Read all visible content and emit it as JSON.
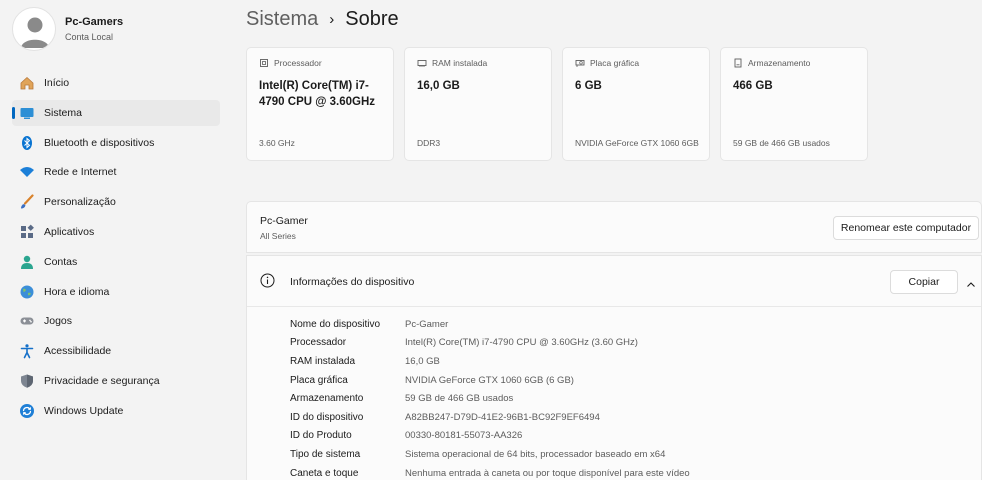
{
  "profile": {
    "name": "Pc-Gamers",
    "account": "Conta Local"
  },
  "nav": [
    {
      "label": "Início",
      "icon": "home-icon"
    },
    {
      "label": "Sistema",
      "icon": "system-icon",
      "active": true
    },
    {
      "label": "Bluetooth e dispositivos",
      "icon": "bluetooth-icon"
    },
    {
      "label": "Rede e Internet",
      "icon": "wifi-icon"
    },
    {
      "label": "Personalização",
      "icon": "brush-icon"
    },
    {
      "label": "Aplicativos",
      "icon": "apps-icon"
    },
    {
      "label": "Contas",
      "icon": "account-icon"
    },
    {
      "label": "Hora e idioma",
      "icon": "globe-icon"
    },
    {
      "label": "Jogos",
      "icon": "gamepad-icon"
    },
    {
      "label": "Acessibilidade",
      "icon": "accessibility-icon"
    },
    {
      "label": "Privacidade e segurança",
      "icon": "shield-icon"
    },
    {
      "label": "Windows Update",
      "icon": "update-icon"
    }
  ],
  "breadcrumb": {
    "parent": "Sistema",
    "separator": "›",
    "current": "Sobre"
  },
  "cards": [
    {
      "title": "Processador",
      "value": "Intel(R) Core(TM) i7-4790 CPU @ 3.60GHz",
      "sub": "3.60 GHz",
      "icon": "processor-icon"
    },
    {
      "title": "RAM instalada",
      "value": "16,0 GB",
      "sub": "DDR3",
      "icon": "ram-icon"
    },
    {
      "title": "Placa gráfica",
      "value": "6 GB",
      "sub": "NVIDIA GeForce GTX 1060 6GB",
      "icon": "gpu-icon"
    },
    {
      "title": "Armazenamento",
      "value": "466 GB",
      "sub": "59 GB de 466 GB usados",
      "icon": "storage-icon"
    }
  ],
  "pc": {
    "name": "Pc-Gamer",
    "model": "All Series",
    "rename_label": "Renomear este computador"
  },
  "device_info": {
    "title": "Informações do dispositivo",
    "copy_label": "Copiar",
    "specs": [
      {
        "label": "Nome do dispositivo",
        "value": "Pc-Gamer"
      },
      {
        "label": "Processador",
        "value": "Intel(R) Core(TM) i7-4790 CPU @ 3.60GHz (3.60 GHz)"
      },
      {
        "label": "RAM instalada",
        "value": "16,0 GB"
      },
      {
        "label": "Placa gráfica",
        "value": "NVIDIA GeForce GTX 1060 6GB (6 GB)"
      },
      {
        "label": "Armazenamento",
        "value": "59 GB de 466 GB usados"
      },
      {
        "label": "ID do dispositivo",
        "value": "A82BB247-D79D-41E2-96B1-BC92F9EF6494"
      },
      {
        "label": "ID do Produto",
        "value": "00330-80181-55073-AA326"
      },
      {
        "label": "Tipo de sistema",
        "value": "Sistema operacional de 64 bits, processador baseado em x64"
      },
      {
        "label": "Caneta e toque",
        "value": "Nenhuma entrada à caneta ou por toque disponível para este vídeo"
      }
    ]
  },
  "colors": {
    "accent": "#0067c0",
    "background": "#f3f3f3",
    "card": "#fbfbfb"
  }
}
